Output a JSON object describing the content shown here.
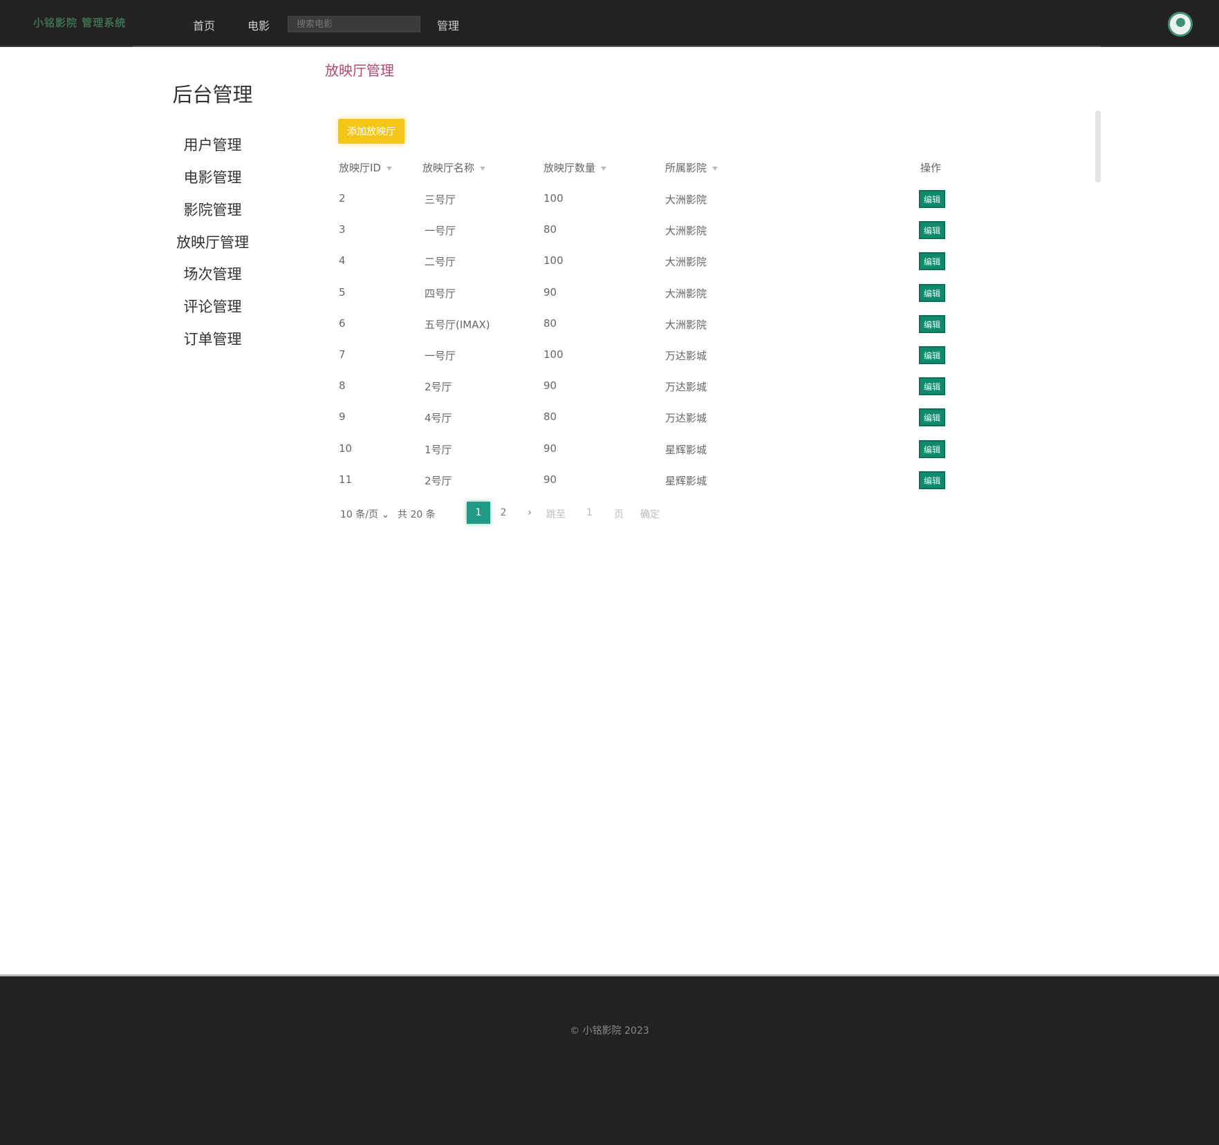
{
  "navbar": {
    "logo": "小铭影院 管理系统",
    "links": [
      "首页",
      "电影",
      "管理"
    ],
    "search_placeholder": "搜索电影"
  },
  "sidebar": {
    "title": "后台管理",
    "items": [
      "用户管理",
      "电影管理",
      "影院管理",
      "放映厅管理",
      "场次管理",
      "评论管理",
      "订单管理"
    ]
  },
  "breadcrumb": "放映厅管理",
  "add_button": "添加放映厅",
  "table": {
    "headers": [
      "放映厅ID",
      "放映厅名称",
      "放映厅数量",
      "所属影院",
      "操作"
    ],
    "rows": [
      {
        "id": "2",
        "name": "三号厅",
        "capacity": "100",
        "cinema": "大洲影院",
        "op": "编辑"
      },
      {
        "id": "3",
        "name": "一号厅",
        "capacity": "80",
        "cinema": "大洲影院",
        "op": "编辑"
      },
      {
        "id": "4",
        "name": "二号厅",
        "capacity": "100",
        "cinema": "大洲影院",
        "op": "编辑"
      },
      {
        "id": "5",
        "name": "四号厅",
        "capacity": "90",
        "cinema": "大洲影院",
        "op": "编辑"
      },
      {
        "id": "6",
        "name": "五号厅(IMAX)",
        "capacity": "80",
        "cinema": "大洲影院",
        "op": "编辑"
      },
      {
        "id": "7",
        "name": "一号厅",
        "capacity": "100",
        "cinema": "万达影城",
        "op": "编辑"
      },
      {
        "id": "8",
        "name": "2号厅",
        "capacity": "90",
        "cinema": "万达影城",
        "op": "编辑"
      },
      {
        "id": "9",
        "name": "4号厅",
        "capacity": "80",
        "cinema": "万达影城",
        "op": "编辑"
      },
      {
        "id": "10",
        "name": "1号厅",
        "capacity": "90",
        "cinema": "星辉影城",
        "op": "编辑"
      },
      {
        "id": "11",
        "name": "2号厅",
        "capacity": "90",
        "cinema": "星辉影城",
        "op": "编辑"
      }
    ]
  },
  "pagination": {
    "page_size": "10 条/页",
    "total": "共 20 条",
    "pages": [
      "1",
      "2"
    ],
    "next": "›",
    "goto_label": "跳至",
    "goto_value": "1",
    "page_unit": "页",
    "confirm": "确定"
  },
  "footer": "© 小铭影院 2023"
}
